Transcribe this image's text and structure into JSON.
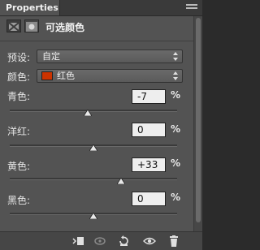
{
  "panel": {
    "tab_title": "Properties"
  },
  "header": {
    "title": "可选颜色",
    "icons": [
      "selective-color-icon",
      "mask-icon"
    ]
  },
  "preset": {
    "label": "预设:",
    "value": "自定"
  },
  "colors": {
    "label": "颜色:",
    "value": "红色",
    "swatch_color": "#cc3300"
  },
  "sliders": [
    {
      "name": "cyan",
      "label": "青色:",
      "value": "-7",
      "unit": "%",
      "position": -7
    },
    {
      "name": "magenta",
      "label": "洋红:",
      "value": "0",
      "unit": "%",
      "position": 0
    },
    {
      "name": "yellow",
      "label": "黄色:",
      "value": "+33",
      "unit": "%",
      "position": 33
    },
    {
      "name": "black",
      "label": "黑色:",
      "value": "0",
      "unit": "%",
      "position": 0
    }
  ],
  "footer_icons": [
    "clip-to-layer-icon",
    "view-previous-icon",
    "reset-icon",
    "visibility-eye-icon",
    "trash-icon"
  ]
}
